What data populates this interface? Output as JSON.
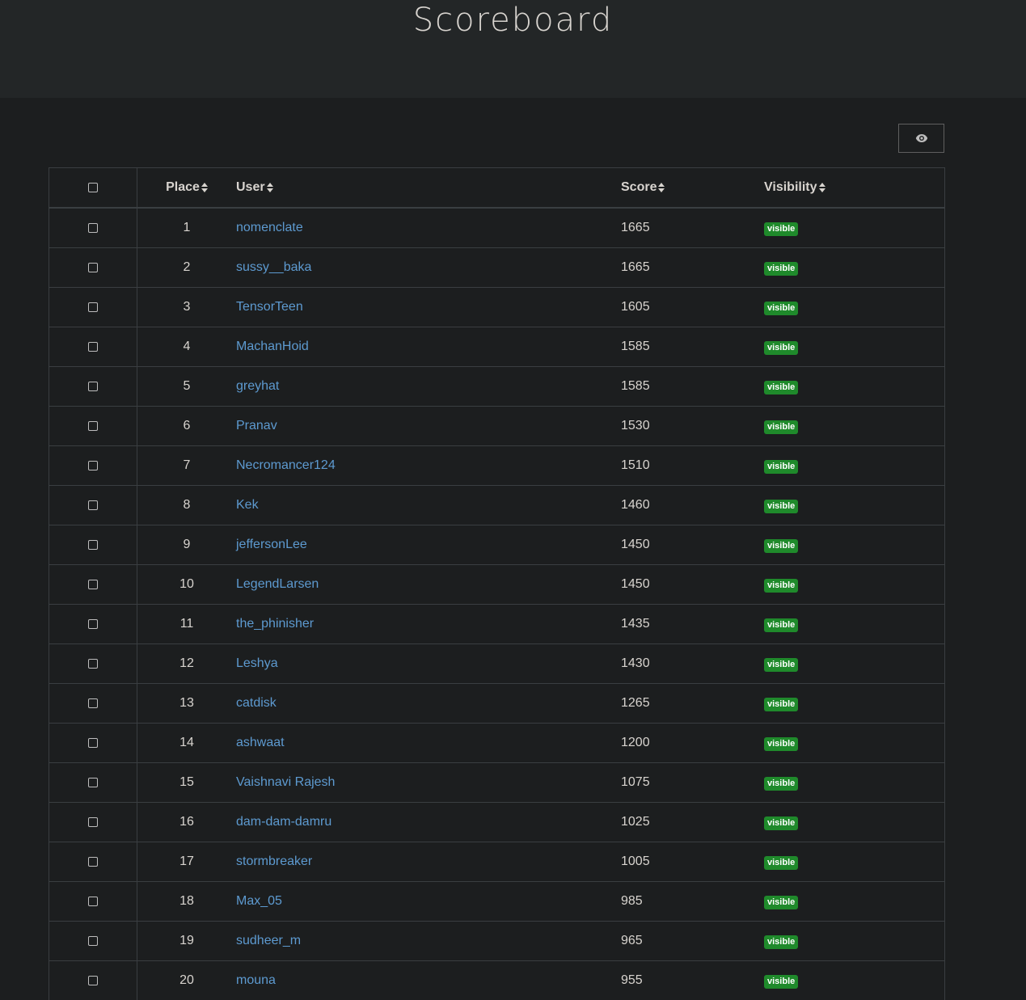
{
  "header": {
    "title": "Scoreboard"
  },
  "toolbar": {
    "toggle_icon": "eye-icon"
  },
  "table": {
    "columns": {
      "place": "Place",
      "user": "User",
      "score": "Score",
      "visibility": "Visibility"
    },
    "rows": [
      {
        "place": "1",
        "user": "nomenclate",
        "score": "1665",
        "visibility": "visible"
      },
      {
        "place": "2",
        "user": "sussy__baka",
        "score": "1665",
        "visibility": "visible"
      },
      {
        "place": "3",
        "user": "TensorTeen",
        "score": "1605",
        "visibility": "visible"
      },
      {
        "place": "4",
        "user": "MachanHoid",
        "score": "1585",
        "visibility": "visible"
      },
      {
        "place": "5",
        "user": "greyhat",
        "score": "1585",
        "visibility": "visible"
      },
      {
        "place": "6",
        "user": "Pranav",
        "score": "1530",
        "visibility": "visible"
      },
      {
        "place": "7",
        "user": "Necromancer124",
        "score": "1510",
        "visibility": "visible"
      },
      {
        "place": "8",
        "user": "Kek",
        "score": "1460",
        "visibility": "visible"
      },
      {
        "place": "9",
        "user": "jeffersonLee",
        "score": "1450",
        "visibility": "visible"
      },
      {
        "place": "10",
        "user": "LegendLarsen",
        "score": "1450",
        "visibility": "visible"
      },
      {
        "place": "11",
        "user": "the_phinisher",
        "score": "1435",
        "visibility": "visible"
      },
      {
        "place": "12",
        "user": "Leshya",
        "score": "1430",
        "visibility": "visible"
      },
      {
        "place": "13",
        "user": "catdisk",
        "score": "1265",
        "visibility": "visible"
      },
      {
        "place": "14",
        "user": "ashwaat",
        "score": "1200",
        "visibility": "visible"
      },
      {
        "place": "15",
        "user": "Vaishnavi Rajesh",
        "score": "1075",
        "visibility": "visible"
      },
      {
        "place": "16",
        "user": "dam-dam-damru",
        "score": "1025",
        "visibility": "visible"
      },
      {
        "place": "17",
        "user": "stormbreaker",
        "score": "1005",
        "visibility": "visible"
      },
      {
        "place": "18",
        "user": "Max_05",
        "score": "985",
        "visibility": "visible"
      },
      {
        "place": "19",
        "user": "sudheer_m",
        "score": "965",
        "visibility": "visible"
      },
      {
        "place": "20",
        "user": "mouna",
        "score": "955",
        "visibility": "visible"
      }
    ]
  },
  "colors": {
    "background": "#1c1e1f",
    "header_bg": "#232627",
    "link": "#5d9ad0",
    "badge_visible": "#1f8a2b"
  }
}
